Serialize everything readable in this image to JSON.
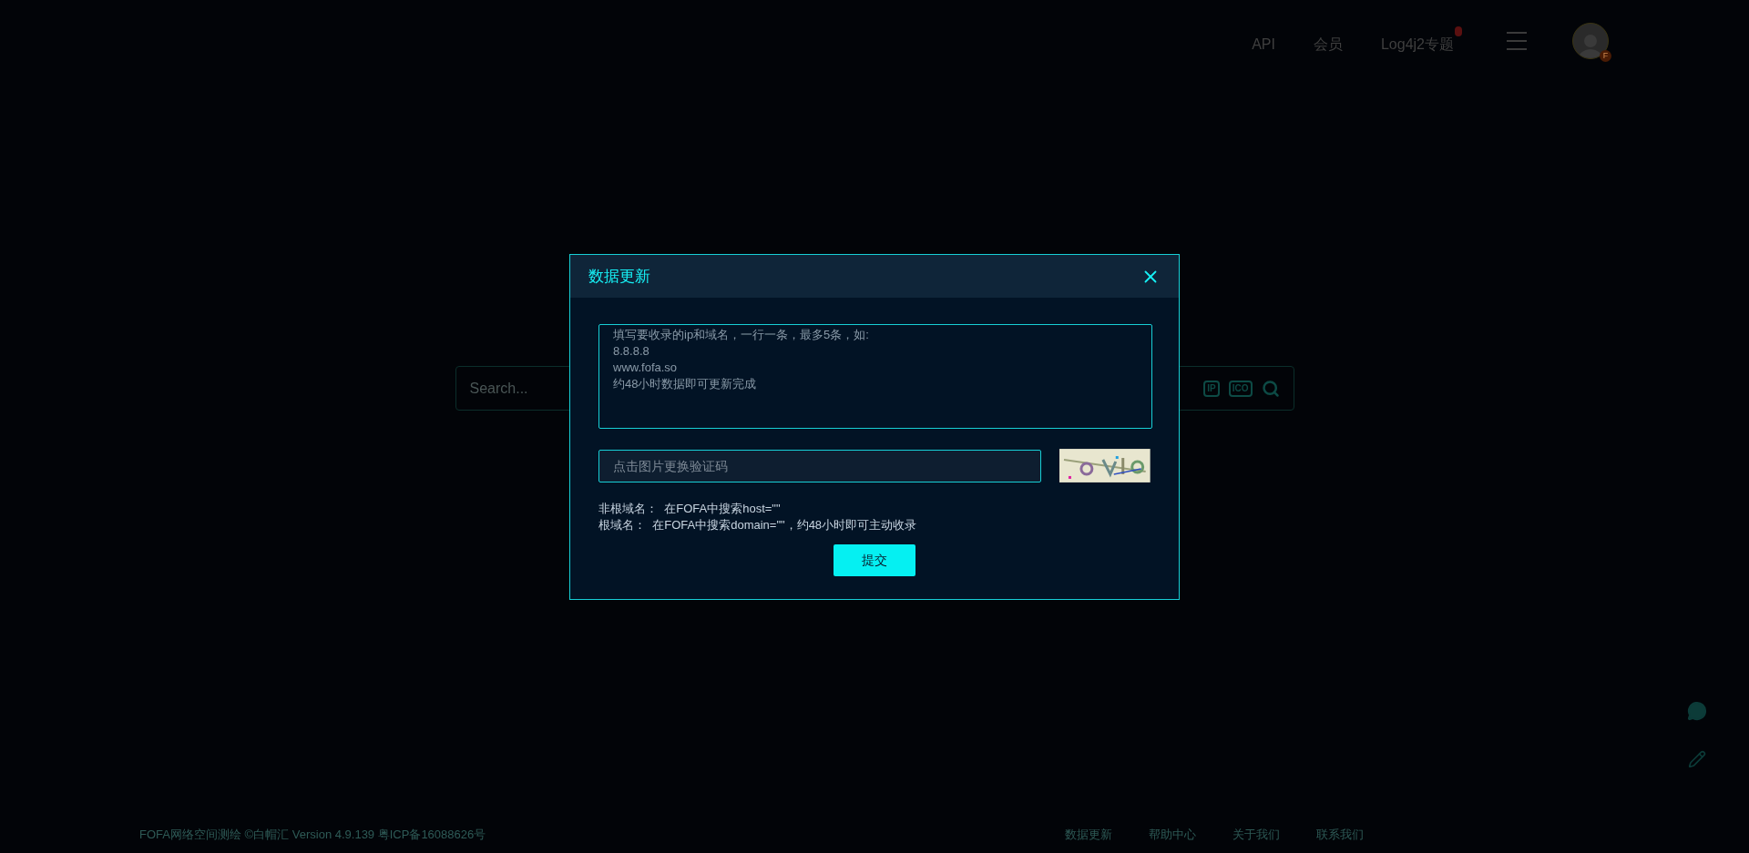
{
  "nav": {
    "links": [
      {
        "label": "API",
        "hot": false
      },
      {
        "label": "会员",
        "hot": false
      },
      {
        "label": "Log4j2专题",
        "hot": true
      }
    ],
    "avatar_badge": "F"
  },
  "search": {
    "placeholder": "Search...",
    "tools": [
      {
        "kind": "ip",
        "label": "IP"
      },
      {
        "kind": "ico",
        "label": "ICO"
      },
      {
        "kind": "search"
      }
    ]
  },
  "dialog": {
    "title": "数据更新",
    "textarea": {
      "placeholder": "填写要收录的ip和域名，一行一条，最多5条，如:\n8.8.8.8\nwww.fofa.so\n约48小时数据即可更新完成"
    },
    "captcha": {
      "placeholder": "点击图片更换验证码"
    },
    "hints": [
      "非根域名：  在FOFA中搜索host=\"\"",
      "根域名：  在FOFA中搜索domain=\"\"，约48小时即可主动收录"
    ],
    "submit": "提交"
  },
  "footer": {
    "text": "FOFA网络空间测绘 ©白帽汇 Version 4.9.139 粤ICP备16088626号",
    "links": [
      "数据更新",
      "帮助中心",
      "关于我们",
      "联系我们"
    ]
  },
  "side_tools": [
    {
      "kind": "chat"
    },
    {
      "kind": "edit"
    }
  ]
}
